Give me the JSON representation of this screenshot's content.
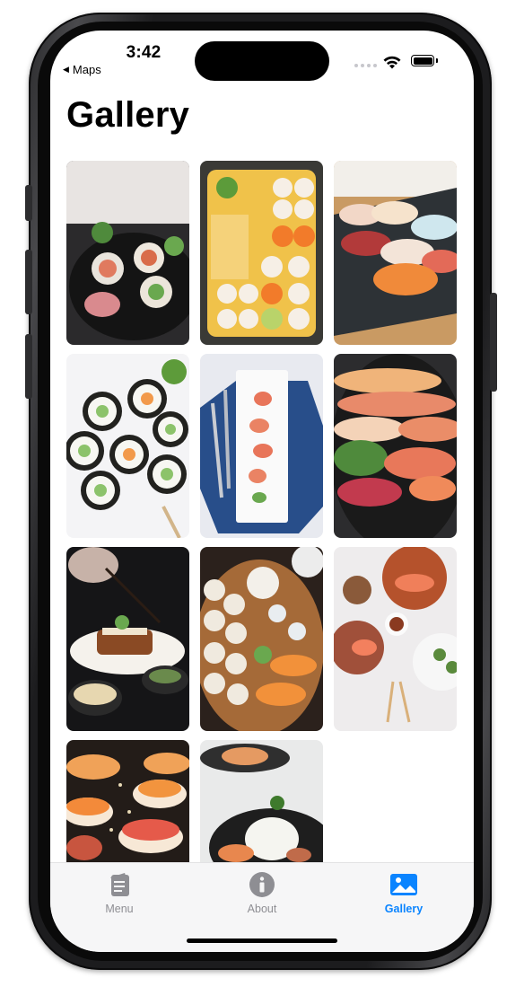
{
  "status_bar": {
    "time": "3:42",
    "back_label": "Maps",
    "back_chevron": "◀"
  },
  "page": {
    "title": "Gallery"
  },
  "gallery": {
    "items": [
      {
        "subject": "sushi rolls on dark plate with pickled ginger"
      },
      {
        "subject": "assorted sushi platter on bamboo mat"
      },
      {
        "subject": "nigiri on slate board"
      },
      {
        "subject": "cucumber and carrot maki on white"
      },
      {
        "subject": "sashimi on rectangular plate with chopsticks"
      },
      {
        "subject": "large sushi party platter"
      },
      {
        "subject": "chef plating sushi with chopsticks"
      },
      {
        "subject": "sushi rolls on wooden board"
      },
      {
        "subject": "top-down tableware with salmon"
      },
      {
        "subject": "salmon nigiri on dark background"
      },
      {
        "subject": "salad and roll with white radish"
      }
    ]
  },
  "tabbar": {
    "tabs": [
      {
        "label": "Menu",
        "icon": "menu-book-icon",
        "selected": false
      },
      {
        "label": "About",
        "icon": "info-circle-icon",
        "selected": false
      },
      {
        "label": "Gallery",
        "icon": "photo-icon",
        "selected": true
      }
    ],
    "accent_color": "#0a84ff",
    "inactive_color": "#8e8e93"
  }
}
